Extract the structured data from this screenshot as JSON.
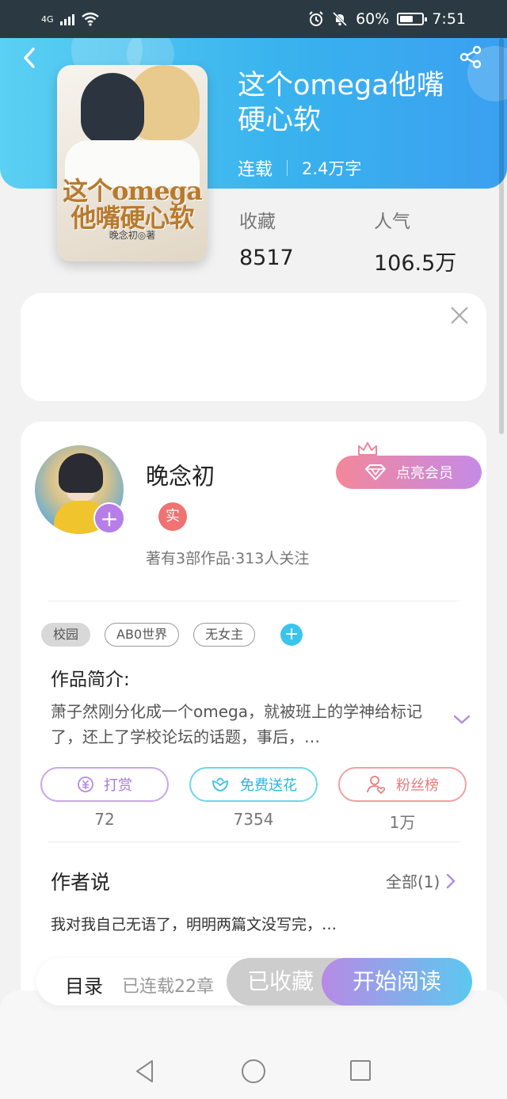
{
  "status_bar": {
    "network": "4G",
    "battery_percent": "60%",
    "time": "7:51",
    "battery_level": 0.6
  },
  "book": {
    "title": "这个omega他嘴硬心软",
    "status": "连载",
    "word_count": "2.4万字",
    "cover": {
      "title_line1": "这个omega",
      "title_line2": "他嘴硬心软",
      "author": "晚念初◎著"
    },
    "stats": [
      {
        "label": "收藏",
        "value": "8517"
      },
      {
        "label": "人气",
        "value": "106.5万"
      }
    ]
  },
  "author": {
    "name": "晚念初",
    "badge": "实",
    "stats_text": "著有3部作品·313人关注",
    "vip_button": "点亮会员",
    "avatar_plus": "+"
  },
  "tags": [
    "校园",
    "AB0世界",
    "无女主"
  ],
  "tag_add": "+",
  "intro": {
    "title": "作品简介:",
    "text": "萧子然刚分化成一个omega，就被班上的学神给标记了，还上了学校论坛的话题，事后，…"
  },
  "actions": [
    {
      "label": "打赏",
      "count": "72",
      "icon": "coin-icon"
    },
    {
      "label": "免费送花",
      "count": "7354",
      "icon": "flower-icon"
    },
    {
      "label": "粉丝榜",
      "count": "1万",
      "icon": "fan-icon"
    }
  ],
  "author_says": {
    "title": "作者说",
    "all_label": "全部(1)",
    "text": "我对我自己无语了，明明两篇文没写完，…"
  },
  "bottom_bar": {
    "toc_label": "目录",
    "toc_count": "已连载22章",
    "favorited": "已收藏",
    "start_reading": "开始阅读"
  },
  "colors": {
    "header_start": "#5ad0f2",
    "header_end": "#3aa0f0",
    "vip_start": "#f3879a",
    "vip_end": "#c58ae6",
    "read_start": "#b78ae6",
    "read_end": "#5cc8ef"
  }
}
